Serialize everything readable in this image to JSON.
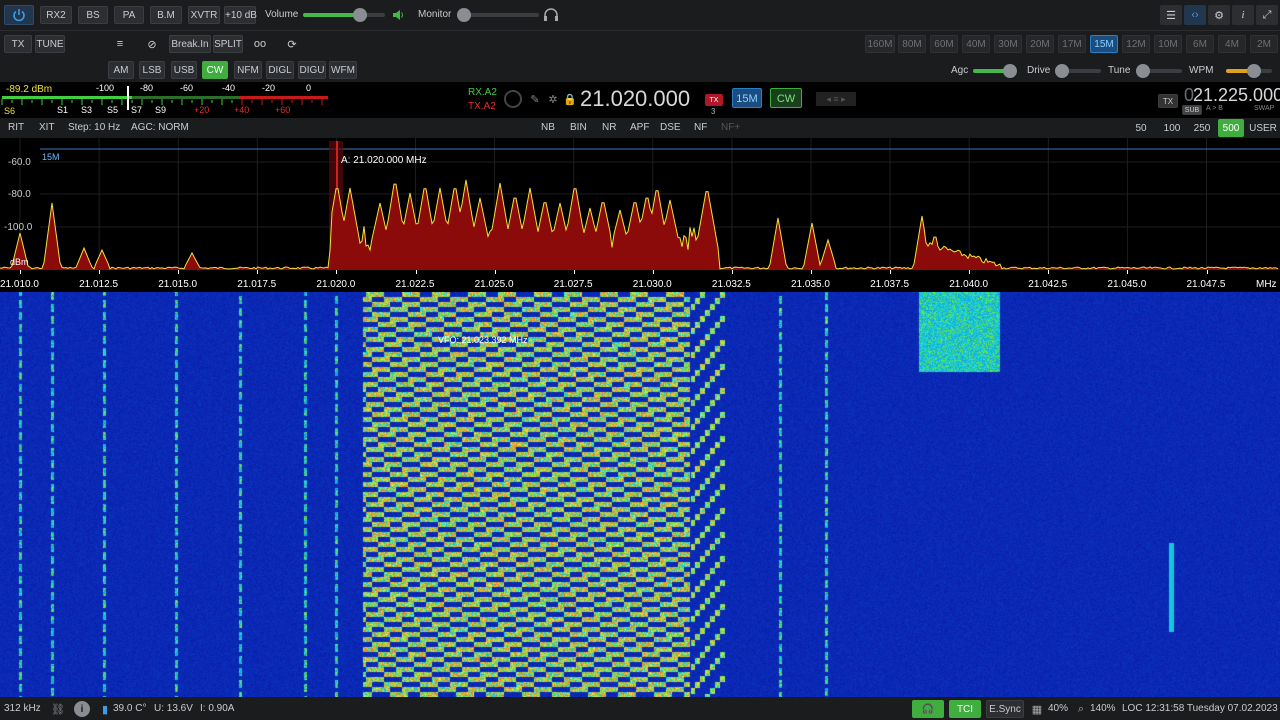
{
  "toolbar1": {
    "power_icon": "power-icon",
    "buttons": [
      "RX2",
      "BS",
      "PA",
      "B.M",
      "XVTR",
      "+10 dB"
    ],
    "volume_label": "Volume",
    "volume_level": 0.7,
    "monitor_label": "Monitor",
    "monitor_level": 0.0
  },
  "toolbar2": {
    "tx": "TX",
    "tune": "TUNE",
    "break_in": "Break.In",
    "split": "SPLIT",
    "bands": [
      "160M",
      "80M",
      "60M",
      "40M",
      "30M",
      "20M",
      "17M",
      "15M",
      "12M",
      "10M",
      "6M",
      "4M",
      "2M"
    ],
    "active_band": "15M"
  },
  "toolbar3": {
    "modes": [
      "AM",
      "LSB",
      "USB",
      "CW",
      "NFM",
      "DIGL",
      "DIGU",
      "WFM"
    ],
    "active_mode": "CW",
    "agc_label": "Agc",
    "drive_label": "Drive",
    "tune_label": "Tune",
    "wpm_label": "WPM",
    "agc_level": 0.85,
    "drive_level": 0.0,
    "tune_level": 0.0,
    "wpm_level": 0.6
  },
  "meter": {
    "dbm": "-89.2 dBm",
    "s_reading": "S6",
    "top_scale": [
      "-100",
      "-80",
      "-60",
      "-40",
      "-20",
      "0"
    ],
    "bottom_scale": [
      "S1",
      "S3",
      "S5",
      "S7",
      "S9",
      "+20",
      "+40",
      "+60"
    ]
  },
  "vfo": {
    "rx": "RX.A2",
    "tx": "TX.A2",
    "freq_a": "21.020.000",
    "band_badge": "15M",
    "mode_badge": "CW",
    "tx_badge": "TX",
    "freq_b_prefix": "0",
    "freq_b": "21.225.000",
    "sub": "SUB",
    "ab": "A > B",
    "swap": "SWAP",
    "sub_badge": "3"
  },
  "row4": {
    "rit": "RIT",
    "xit": "XIT",
    "step": "Step: 10 Hz",
    "agc": "AGC: NORM",
    "dsp": [
      "NB",
      "BIN",
      "NR",
      "APF",
      "DSE",
      "NF",
      "NF+"
    ],
    "filters": [
      "50",
      "100",
      "250",
      "500",
      "USER"
    ],
    "active_filter": "500"
  },
  "spectrum": {
    "band_tag": "15M",
    "marker": "A: 21.020.000 MHz",
    "db_ticks": [
      "-60.0",
      "-80.0",
      "-100.0"
    ],
    "unit": "dBm",
    "freq_ticks": [
      "21.010.0",
      "21.012.5",
      "21.015.0",
      "21.017.5",
      "21.020.0",
      "21.022.5",
      "21.025.0",
      "21.027.5",
      "21.030.0",
      "21.032.5",
      "21.035.0",
      "21.037.5",
      "21.040.0",
      "21.042.5",
      "21.045.0",
      "21.047.5"
    ],
    "freq_unit": "MHz"
  },
  "waterfall": {
    "vfo_label": "VFO: 21.023.392 MHz"
  },
  "status": {
    "span": "312 kHz",
    "temp": "39.0 C°",
    "voltage": "U: 13.6V",
    "current": "I: 0.90A",
    "tci": "TCI",
    "esync": "E.Sync",
    "cpu": "40%",
    "zoom": "140%",
    "clock": "LOC 12:31:58  Tuesday 07.02.2023"
  },
  "colors": {
    "accent_green": "#3fae3f",
    "accent_blue": "#2a7fc4",
    "spectrum_fill": "#8b0a0a",
    "spectrum_line": "#f2e23a",
    "waterfall_base": "#0a1fa8"
  }
}
